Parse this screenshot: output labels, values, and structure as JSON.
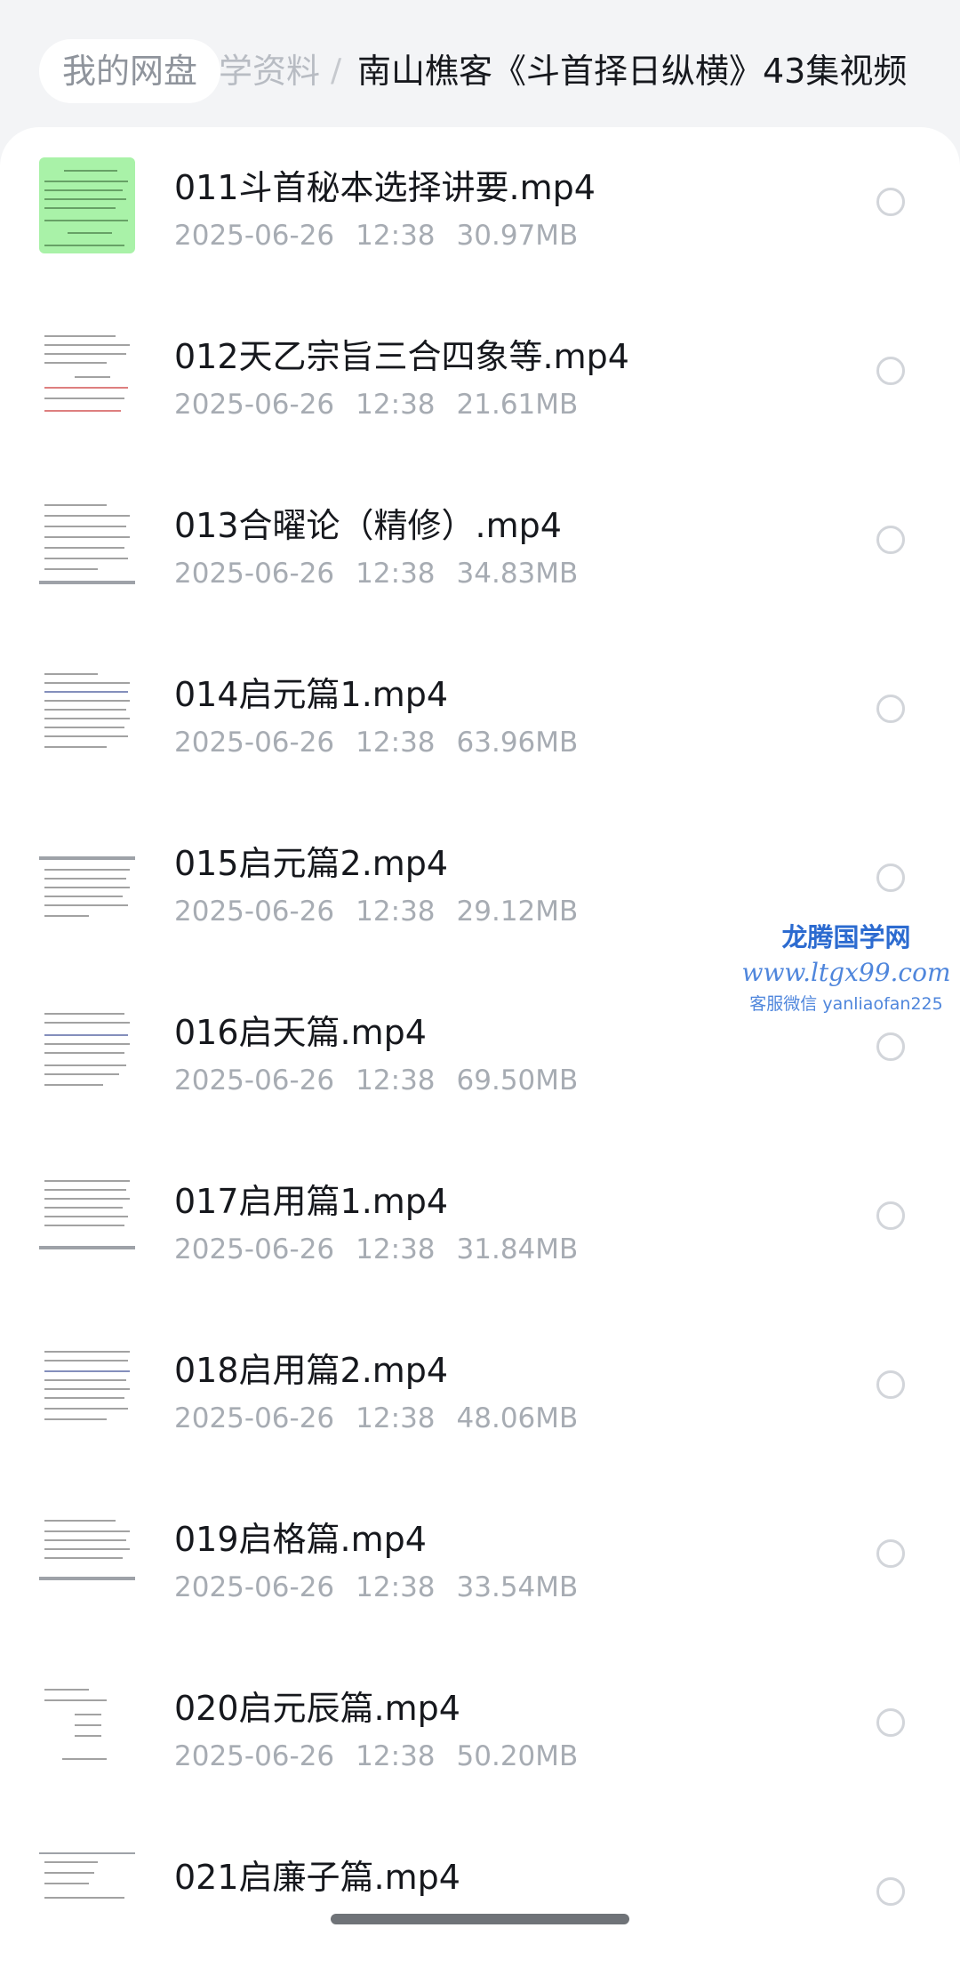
{
  "breadcrumb": {
    "root": "我的网盘",
    "middle": "学资料",
    "separator": "/",
    "current": "南山樵客《斗首择日纵横》43集视频"
  },
  "files": [
    {
      "name": "011斗首秘本选择讲要.mp4",
      "date": "2025-06-26",
      "time": "12:38",
      "size": "30.97MB",
      "thumbnail": "green-document"
    },
    {
      "name": "012天乙宗旨三合四象等.mp4",
      "date": "2025-06-26",
      "time": "12:38",
      "size": "21.61MB",
      "thumbnail": "document"
    },
    {
      "name": "013合曜论（精修）.mp4",
      "date": "2025-06-26",
      "time": "12:38",
      "size": "34.83MB",
      "thumbnail": "document"
    },
    {
      "name": "014启元篇1.mp4",
      "date": "2025-06-26",
      "time": "12:38",
      "size": "63.96MB",
      "thumbnail": "document"
    },
    {
      "name": "015启元篇2.mp4",
      "date": "2025-06-26",
      "time": "12:38",
      "size": "29.12MB",
      "thumbnail": "document"
    },
    {
      "name": "016启天篇.mp4",
      "date": "2025-06-26",
      "time": "12:38",
      "size": "69.50MB",
      "thumbnail": "document"
    },
    {
      "name": "017启用篇1.mp4",
      "date": "2025-06-26",
      "time": "12:38",
      "size": "31.84MB",
      "thumbnail": "document"
    },
    {
      "name": "018启用篇2.mp4",
      "date": "2025-06-26",
      "time": "12:38",
      "size": "48.06MB",
      "thumbnail": "document"
    },
    {
      "name": "019启格篇.mp4",
      "date": "2025-06-26",
      "time": "12:38",
      "size": "33.54MB",
      "thumbnail": "document"
    },
    {
      "name": "020启元辰篇.mp4",
      "date": "2025-06-26",
      "time": "12:38",
      "size": "50.20MB",
      "thumbnail": "document"
    },
    {
      "name": "021启廉子篇.mp4",
      "date": "",
      "time": "",
      "size": "",
      "thumbnail": "document"
    }
  ],
  "watermark": {
    "title": "龙腾国学网",
    "url": "www.ltgx99.com",
    "contact": "客服微信 yanliaofan225"
  },
  "colors": {
    "accent_watermark": "#2c6bd0",
    "meta_text": "#a7acb3",
    "thumb_green": "#a9f2a8"
  }
}
